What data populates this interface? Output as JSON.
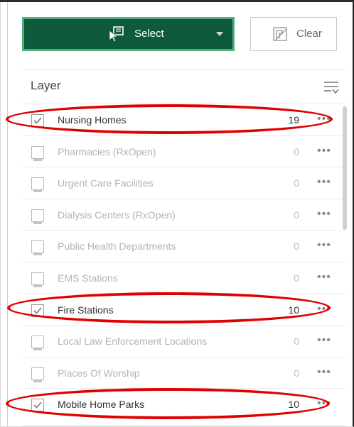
{
  "toolbar": {
    "select_label": "Select",
    "clear_label": "Clear",
    "select_icon": "select-cursor-icon",
    "clear_icon": "clear-selection-icon"
  },
  "panel": {
    "heading": "Layer",
    "sort_icon": "sort-filter-icon"
  },
  "layers": [
    {
      "name": "Nursing Homes",
      "count": "19",
      "checked": true
    },
    {
      "name": "Pharmacies (RxOpen)",
      "count": "0",
      "checked": false
    },
    {
      "name": "Urgent Care Facilities",
      "count": "0",
      "checked": false
    },
    {
      "name": "Dialysis Centers (RxOpen)",
      "count": "0",
      "checked": false
    },
    {
      "name": "Public Health Departments",
      "count": "0",
      "checked": false
    },
    {
      "name": "EMS Stations",
      "count": "0",
      "checked": false
    },
    {
      "name": "Fire Stations",
      "count": "10",
      "checked": true
    },
    {
      "name": "Local Law Enforcement Locations",
      "count": "0",
      "checked": false
    },
    {
      "name": "Places Of Worship",
      "count": "0",
      "checked": false
    },
    {
      "name": "Mobile Home Parks",
      "count": "10",
      "checked": true
    }
  ],
  "more_glyph": "•••",
  "colors": {
    "select_bg": "#0e5a3a",
    "select_border": "#4fae79",
    "annotation": "#e00000"
  }
}
